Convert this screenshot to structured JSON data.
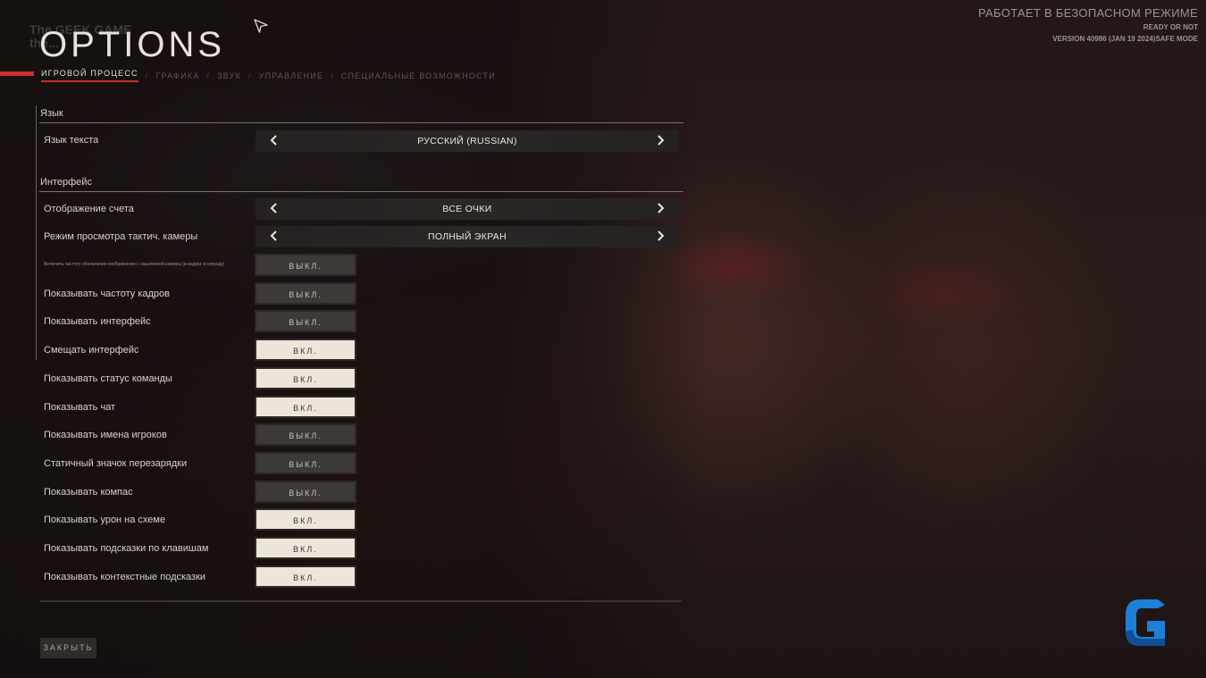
{
  "watermark": {
    "line1": "The GEEK GAME",
    "line2": "the..."
  },
  "title": "OPTIONS",
  "status": {
    "mode": "РАБОТАЕТ В БЕЗОПАСНОМ РЕЖИМЕ",
    "game": "READY OR NOT",
    "version": "VERSION 40986 (JAN 19 2024)SAFE MODE"
  },
  "tabs": [
    {
      "label": "ИГРОВОЙ ПРОЦЕСС",
      "active": true
    },
    {
      "label": "ГРАФИКА"
    },
    {
      "label": "ЗВУК"
    },
    {
      "label": "УПРАВЛЕНИЕ"
    },
    {
      "label": "СПЕЦИАЛЬНЫЕ ВОЗМОЖНОСТИ"
    }
  ],
  "tab_separator": "/",
  "sections": {
    "language": "Язык",
    "interface": "Интерфейс"
  },
  "selectors": [
    {
      "label": "Язык текста",
      "value": "РУССКИЙ (RUSSIAN)"
    },
    {
      "label": "Отображение счета",
      "value": "ВСЕ ОЧКИ"
    },
    {
      "label": "Режим просмотра тактич. камеры",
      "value": "ПОЛНЫЙ ЭКРАН"
    }
  ],
  "toggles": [
    {
      "label": "Включить частоту обновления изображения с нашлемной камеры (в кадрах в секунду)",
      "value": "ВЫКЛ.",
      "on": false
    },
    {
      "label": "Показывать частоту кадров",
      "value": "ВЫКЛ.",
      "on": false
    },
    {
      "label": "Показывать интерфейс",
      "value": "ВЫКЛ.",
      "on": false
    },
    {
      "label": "Смещать интерфейс",
      "value": "ВКЛ.",
      "on": true
    },
    {
      "label": "Показывать статус команды",
      "value": "ВКЛ.",
      "on": true
    },
    {
      "label": "Показывать чат",
      "value": "ВКЛ.",
      "on": true
    },
    {
      "label": "Показывать имена игроков",
      "value": "ВЫКЛ.",
      "on": false
    },
    {
      "label": "Статичный значок перезарядки",
      "value": "ВЫКЛ.",
      "on": false
    },
    {
      "label": "Показывать компас",
      "value": "ВЫКЛ.",
      "on": false
    },
    {
      "label": "Показывать урон на схеме",
      "value": "ВКЛ.",
      "on": true
    },
    {
      "label": "Показывать подсказки по клавишам",
      "value": "ВКЛ.",
      "on": true
    },
    {
      "label": "Показывать контекстные подсказки",
      "value": "ВКЛ.",
      "on": true
    }
  ],
  "close_label": "ЗАКРЫТЬ",
  "icons": {
    "cursor": "mouse-cursor-icon",
    "prev": "chevron-left-icon",
    "next": "chevron-right-icon",
    "logo": "geek-game-logo-icon"
  },
  "colors": {
    "accent": "#c8302c",
    "toggle_on": "#ece6da",
    "toggle_off": "#3d3937",
    "logo_blue": "#1e7fd8"
  }
}
